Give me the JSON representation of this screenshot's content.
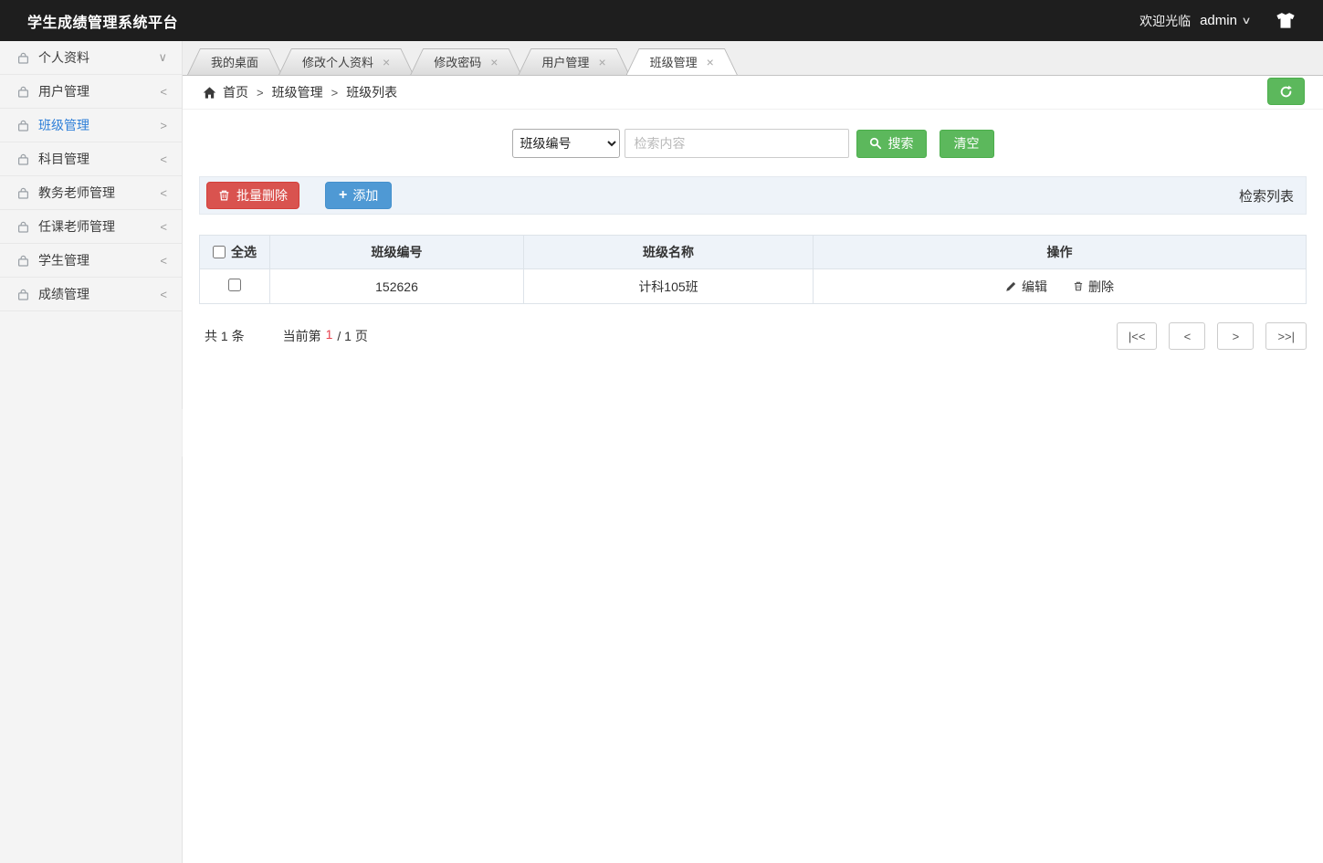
{
  "colors": {
    "topbar_bg": "#1e1e1e",
    "accent_green": "#5cb85c",
    "danger_red": "#d9534f",
    "primary_blue": "#4f99d4",
    "active_link_blue": "#2e7fd8",
    "current_page_red": "#e8434f",
    "panel_heading_bg": "#eef3f9"
  },
  "ui": {
    "close": "×",
    "caret": "∨",
    "plus": "+"
  },
  "header": {
    "title": "学生成绩管理系统平台",
    "welcome": "欢迎光临",
    "username": "admin"
  },
  "sidebar": {
    "items": [
      {
        "label": "个人资料",
        "arrow": "∨"
      },
      {
        "label": "用户管理",
        "arrow": "<"
      },
      {
        "label": "班级管理",
        "arrow": ">",
        "active": true
      },
      {
        "label": "科目管理",
        "arrow": "<"
      },
      {
        "label": "教务老师管理",
        "arrow": "<"
      },
      {
        "label": "任课老师管理",
        "arrow": "<"
      },
      {
        "label": "学生管理",
        "arrow": "<"
      },
      {
        "label": "成绩管理",
        "arrow": "<"
      }
    ]
  },
  "tabs": [
    {
      "label": "我的桌面"
    },
    {
      "label": "修改个人资料"
    },
    {
      "label": "修改密码"
    },
    {
      "label": "用户管理"
    },
    {
      "label": "班级管理",
      "active": true
    }
  ],
  "breadcrumb": {
    "home": "首页",
    "sep": ">",
    "level2": "班级管理",
    "level3": "班级列表"
  },
  "search": {
    "field_selected": "班级编号",
    "placeholder": "检索内容",
    "search_label": "搜索",
    "clear_label": "清空"
  },
  "toolbar": {
    "batch_delete": "批量删除",
    "add": "添加",
    "right_label": "检索列表"
  },
  "table": {
    "select_all": "全选",
    "columns": {
      "class_no": "班级编号",
      "class_name": "班级名称",
      "actions": "操作"
    },
    "rows": [
      {
        "class_no": "152626",
        "class_name": "计科105班"
      }
    ],
    "edit_label": "编辑",
    "delete_label": "删除"
  },
  "pagination": {
    "total": "共 1 条",
    "current_prefix": "当前第",
    "current": "1",
    "suffix": "/ 1 页",
    "buttons": [
      "|<<",
      "<",
      ">",
      ">>|"
    ]
  }
}
